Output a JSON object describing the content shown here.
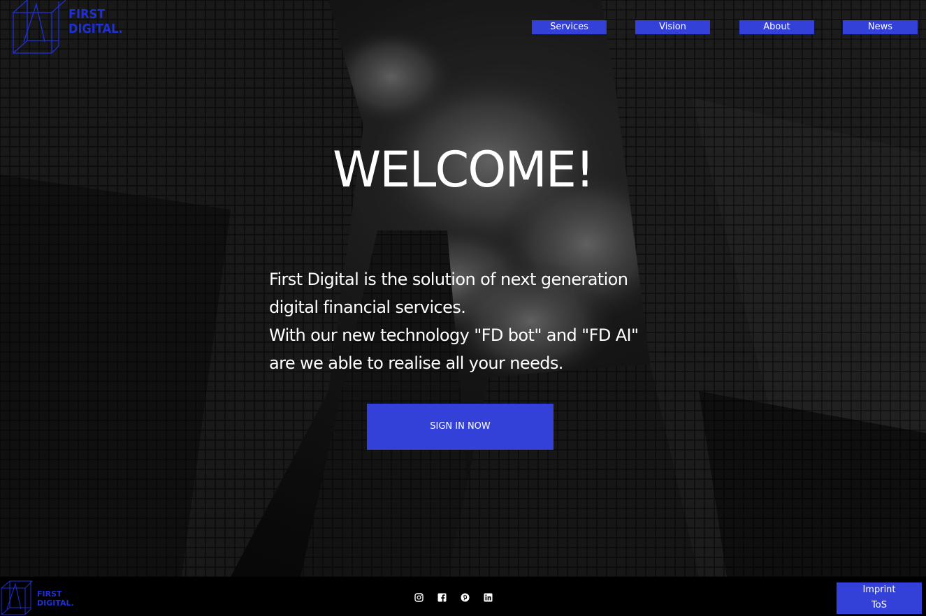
{
  "brand": {
    "logo_line1": "FIRST",
    "logo_line2": "DIGITAL.",
    "accent_color": "#3441d9",
    "logo_color": "#1f2fd6"
  },
  "nav": {
    "items": [
      {
        "label": "Services"
      },
      {
        "label": "Vision"
      },
      {
        "label": "About"
      },
      {
        "label": "News"
      }
    ]
  },
  "hero": {
    "headline": "WELCOME!",
    "intro_lines": [
      "First Digital is the solution of next generation",
      "digital financial services.",
      "With our new technology \"FD bot\" and \"FD AI\"",
      "are we able to realise all your needs."
    ],
    "cta_label": "SIGN IN NOW"
  },
  "footer": {
    "logo_line1": "FIRST",
    "logo_line2": "DIGITAL.",
    "social_icons": [
      "instagram-icon",
      "facebook-icon",
      "pinterest-icon",
      "linkedin-icon"
    ],
    "imprint_label": "Imprint",
    "tos_label": "ToS"
  }
}
